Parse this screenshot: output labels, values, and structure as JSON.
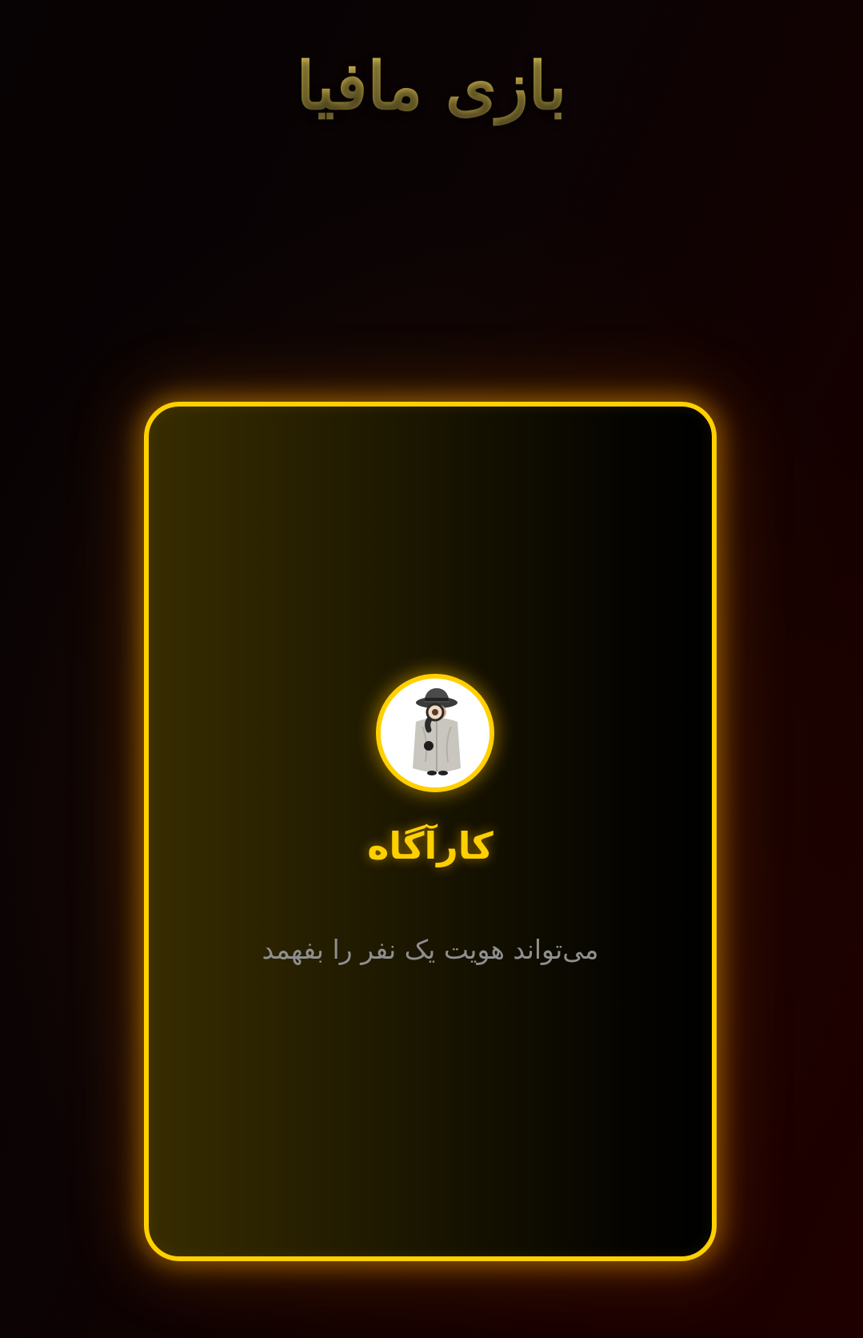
{
  "app": {
    "title": "بازی مافیا"
  },
  "role_card": {
    "name": "کارآگاه",
    "description": "می‌تواند هویت یک نفر را بفهمد",
    "avatar_icon": "detective-with-magnifying-glass-icon"
  },
  "colors": {
    "accent": "#ffd000",
    "title_gold": "#d4bd50",
    "description_text": "#8f8f8f",
    "background_dark": "#070203",
    "background_red": "#1f0000"
  }
}
